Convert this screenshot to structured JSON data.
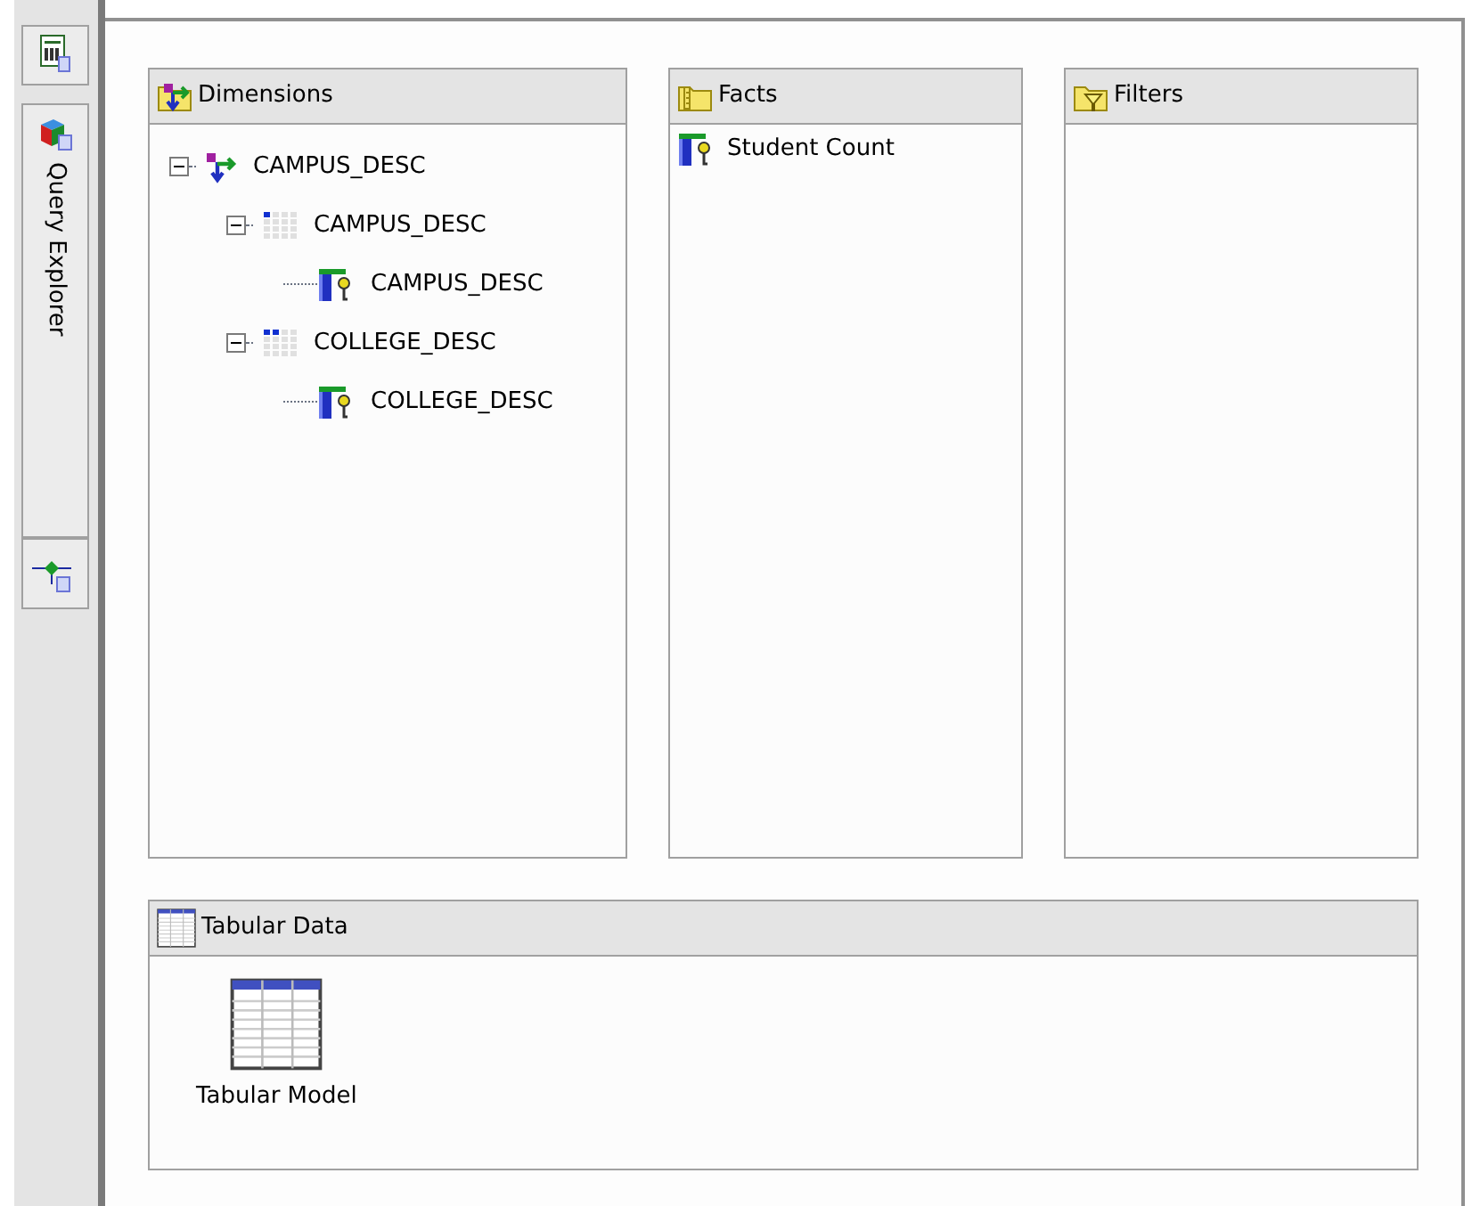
{
  "side_tabs": [
    {
      "kind": "report"
    },
    {
      "kind": "explorer",
      "label": "Query Explorer"
    },
    {
      "kind": "diagram"
    }
  ],
  "dimensions": {
    "title": "Dimensions",
    "items": [
      {
        "kind": "dimension",
        "label": "CAMPUS_DESC",
        "expanded": true,
        "children": [
          {
            "kind": "hierarchy",
            "label": "CAMPUS_DESC",
            "expanded": true,
            "children": [
              {
                "kind": "level",
                "label": "CAMPUS_DESC"
              }
            ]
          },
          {
            "kind": "hierarchy",
            "label": "COLLEGE_DESC",
            "expanded": true,
            "children": [
              {
                "kind": "level",
                "label": "COLLEGE_DESC"
              }
            ]
          }
        ]
      }
    ]
  },
  "facts": {
    "title": "Facts",
    "items": [
      {
        "label": "Student Count"
      }
    ]
  },
  "filters": {
    "title": "Filters"
  },
  "tabular_data": {
    "title": "Tabular Data",
    "items": [
      {
        "label": "Tabular Model"
      }
    ]
  }
}
